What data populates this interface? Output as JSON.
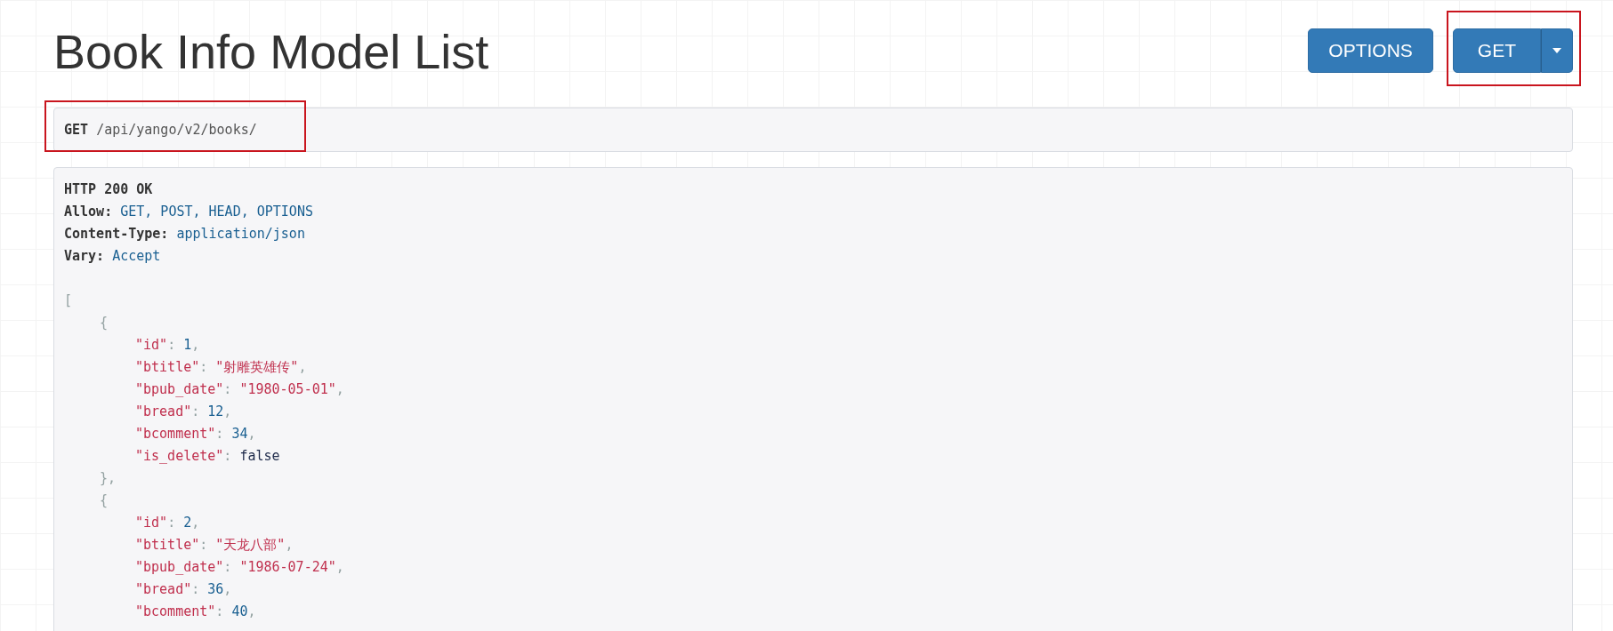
{
  "title": "Book Info Model List",
  "buttons": [
    {
      "label": "OPTIONS",
      "kind": "plain"
    },
    {
      "label": "GET",
      "kind": "split"
    }
  ],
  "request": {
    "method": "GET",
    "url": "/api/yango/v2/books/"
  },
  "response": {
    "status": "HTTP 200 OK",
    "headers": [
      {
        "name": "Allow:",
        "value": "GET, POST, HEAD, OPTIONS"
      },
      {
        "name": "Content-Type:",
        "value": "application/json"
      },
      {
        "name": "Vary:",
        "value": "Accept"
      }
    ],
    "body": {
      "open": "[",
      "children": [
        {
          "open": "{",
          "close": "},",
          "fields": [
            {
              "key": "\"id\"",
              "colon": ":",
              "value": "1",
              "kind": "number",
              "comma": ","
            },
            {
              "key": "\"btitle\"",
              "colon": ":",
              "value": "\"射雕英雄传\"",
              "kind": "string",
              "comma": ","
            },
            {
              "key": "\"bpub_date\"",
              "colon": ":",
              "value": "\"1980-05-01\"",
              "kind": "string",
              "comma": ","
            },
            {
              "key": "\"bread\"",
              "colon": ":",
              "value": "12",
              "kind": "number",
              "comma": ","
            },
            {
              "key": "\"bcomment\"",
              "colon": ":",
              "value": "34",
              "kind": "number",
              "comma": ","
            },
            {
              "key": "\"is_delete\"",
              "colon": ":",
              "value": "false",
              "kind": "keyword"
            }
          ]
        },
        {
          "open": "{",
          "fields": [
            {
              "key": "\"id\"",
              "colon": ":",
              "value": "2",
              "kind": "number",
              "comma": ","
            },
            {
              "key": "\"btitle\"",
              "colon": ":",
              "value": "\"天龙八部\"",
              "kind": "string",
              "comma": ","
            },
            {
              "key": "\"bpub_date\"",
              "colon": ":",
              "value": "\"1986-07-24\"",
              "kind": "string",
              "comma": ","
            },
            {
              "key": "\"bread\"",
              "colon": ":",
              "value": "36",
              "kind": "number",
              "comma": ","
            },
            {
              "key": "\"bcomment\"",
              "colon": ":",
              "value": "40",
              "kind": "number",
              "comma": ","
            }
          ]
        }
      ]
    }
  }
}
